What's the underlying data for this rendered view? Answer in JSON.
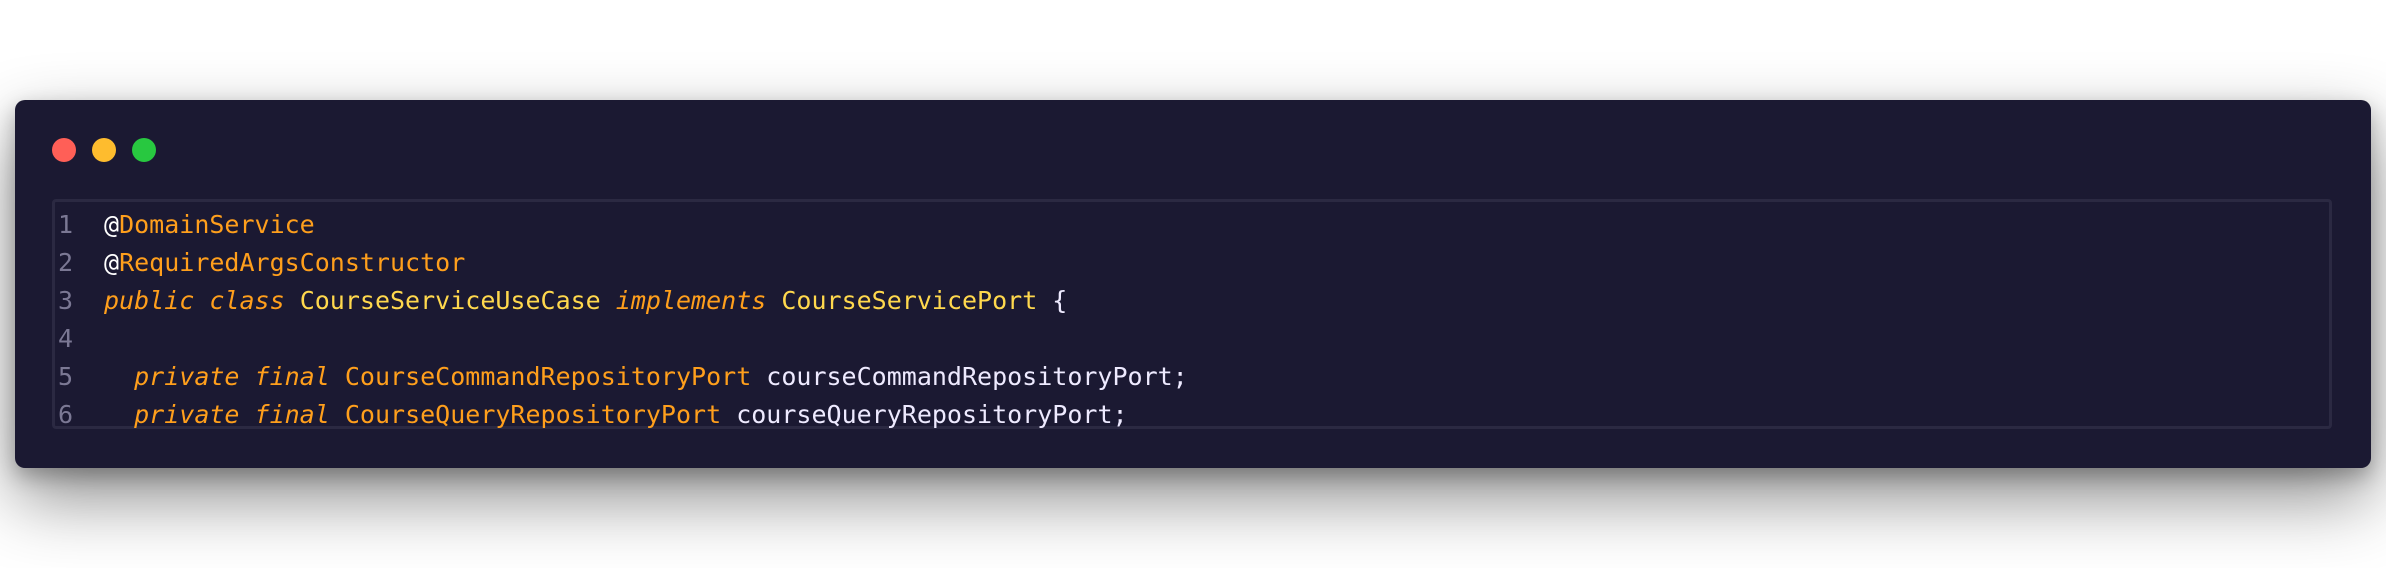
{
  "window": {
    "controls": [
      "close",
      "minimize",
      "maximize"
    ]
  },
  "code": {
    "lines": [
      {
        "number": "1",
        "tokens": [
          {
            "text": "@",
            "kind": "at"
          },
          {
            "text": "DomainService",
            "kind": "anno"
          }
        ]
      },
      {
        "number": "2",
        "tokens": [
          {
            "text": "@",
            "kind": "at"
          },
          {
            "text": "RequiredArgsConstructor",
            "kind": "anno"
          }
        ]
      },
      {
        "number": "3",
        "tokens": [
          {
            "text": "public",
            "kind": "kw"
          },
          {
            "text": " ",
            "kind": "plain"
          },
          {
            "text": "class",
            "kind": "kw"
          },
          {
            "text": " ",
            "kind": "plain"
          },
          {
            "text": "CourseServiceUseCase",
            "kind": "type"
          },
          {
            "text": " ",
            "kind": "plain"
          },
          {
            "text": "implements",
            "kind": "kw"
          },
          {
            "text": " ",
            "kind": "plain"
          },
          {
            "text": "CourseServicePort",
            "kind": "type"
          },
          {
            "text": " {",
            "kind": "plain"
          }
        ]
      },
      {
        "number": "4",
        "tokens": []
      },
      {
        "number": "5",
        "tokens": [
          {
            "text": "  ",
            "kind": "plain"
          },
          {
            "text": "private",
            "kind": "kw"
          },
          {
            "text": " ",
            "kind": "plain"
          },
          {
            "text": "final",
            "kind": "kw"
          },
          {
            "text": " ",
            "kind": "plain"
          },
          {
            "text": "CourseCommandRepositoryPort",
            "kind": "type2"
          },
          {
            "text": " courseCommandRepositoryPort;",
            "kind": "plain"
          }
        ]
      },
      {
        "number": "6",
        "tokens": [
          {
            "text": "  ",
            "kind": "plain"
          },
          {
            "text": "private",
            "kind": "kw"
          },
          {
            "text": " ",
            "kind": "plain"
          },
          {
            "text": "final",
            "kind": "kw"
          },
          {
            "text": " ",
            "kind": "plain"
          },
          {
            "text": "CourseQueryRepositoryPort",
            "kind": "type2"
          },
          {
            "text": " courseQueryRepositoryPort;",
            "kind": "plain"
          }
        ]
      }
    ]
  },
  "colors": {
    "background": "#1b1932",
    "annotation": "#ff9f1c",
    "keyword": "#ff9f1c",
    "type": "#ffd84d",
    "text": "#eeeaff",
    "line_number": "#7b7894"
  }
}
